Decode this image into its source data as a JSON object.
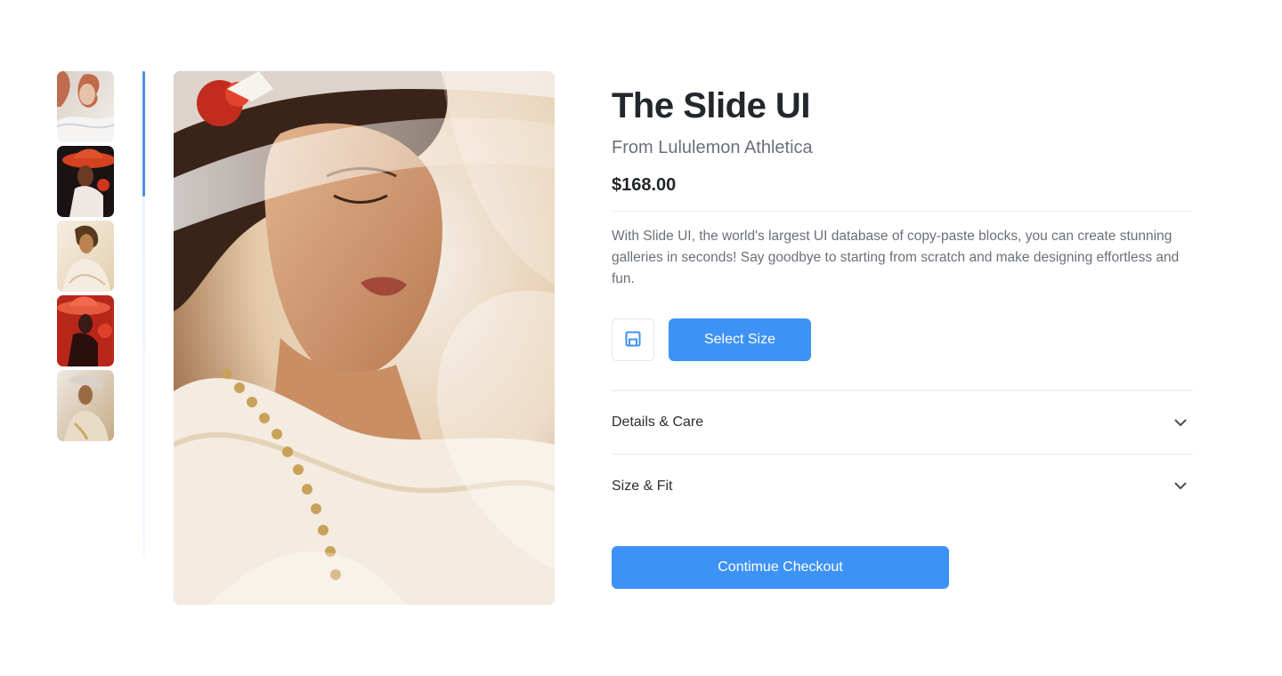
{
  "gallery": {
    "thumbnails": [
      {
        "icon": "portrait-thumbnail-1",
        "palette": [
          "#e9e4df",
          "#c9745a",
          "#f2eee9"
        ]
      },
      {
        "icon": "portrait-thumbnail-2",
        "palette": [
          "#1b1414",
          "#d2401f",
          "#6d3a26"
        ]
      },
      {
        "icon": "portrait-thumbnail-3",
        "palette": [
          "#f1e7d6",
          "#8a5a2e",
          "#e8d6b8"
        ]
      },
      {
        "icon": "portrait-thumbnail-4",
        "palette": [
          "#c42a1c",
          "#2a1210",
          "#e2563d"
        ]
      },
      {
        "icon": "portrait-thumbnail-5",
        "palette": [
          "#ece6e0",
          "#7a5232",
          "#d9c3a5"
        ]
      }
    ],
    "selected_index": 1,
    "main_image_icon": "portrait-main-image"
  },
  "product": {
    "title": "The Slide UI",
    "brand": "From Lululemon Athletica",
    "price": "$168.00",
    "description": "With Slide UI, the world's largest UI database of copy-paste blocks, you can create stunning galleries in seconds! Say goodbye to starting from scratch and make designing effortless and fun."
  },
  "actions": {
    "save_icon": "floppy-disk-icon",
    "select_size_label": "Select Size"
  },
  "accordion": [
    {
      "label": "Details & Care",
      "icon": "chevron-down-icon"
    },
    {
      "label": "Size & Fit",
      "icon": "chevron-down-icon"
    }
  ],
  "checkout": {
    "label": "Contimue Checkout"
  },
  "colors": {
    "accent": "#3d92f5",
    "scroll_indicator": "#4a90e2",
    "text_primary": "#23272b",
    "text_secondary": "#6b7078"
  }
}
